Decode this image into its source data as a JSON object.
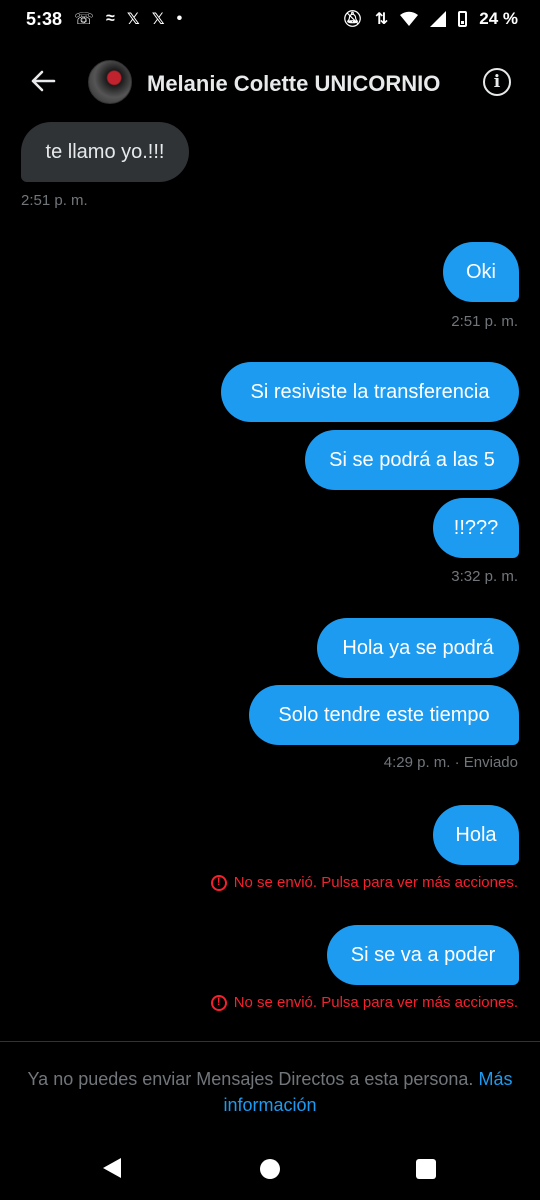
{
  "status_bar": {
    "time": "5:38",
    "left_icons": [
      "missed-call-icon",
      "app-icon",
      "x-icon",
      "x-icon",
      "dot-icon"
    ],
    "battery_percent": "24 %"
  },
  "header": {
    "contact_name": "Melanie Colette UNICORNIO",
    "info_glyph": "i"
  },
  "messages": [
    {
      "direction": "in",
      "text": "te llamo yo.!!!"
    },
    {
      "direction": "out",
      "text": "Oki"
    },
    {
      "direction": "out",
      "text": "Si resiviste la transferencia"
    },
    {
      "direction": "out",
      "text": "Si se podrá a las 5"
    },
    {
      "direction": "out",
      "text": "!!???"
    },
    {
      "direction": "out",
      "text": "Hola ya se podrá"
    },
    {
      "direction": "out",
      "text": "Solo tendre este tiempo"
    },
    {
      "direction": "out",
      "text": "Hola"
    },
    {
      "direction": "out",
      "text": "Si se va a poder"
    }
  ],
  "meta": {
    "t1": "2:51 p. m.",
    "t2": "2:51 p. m.",
    "t3": "3:32 p. m.",
    "t4": "4:29 p. m. · Enviado",
    "error_text": "No se envió. Pulsa para ver más acciones."
  },
  "footer": {
    "notice": "Ya no puedes enviar Mensajes Directos a esta persona.",
    "link": "Más información"
  },
  "colors": {
    "accent": "#1d9bf0",
    "incoming_bubble": "#2f3336",
    "error": "#f4212e",
    "secondary_text": "#71767b"
  }
}
